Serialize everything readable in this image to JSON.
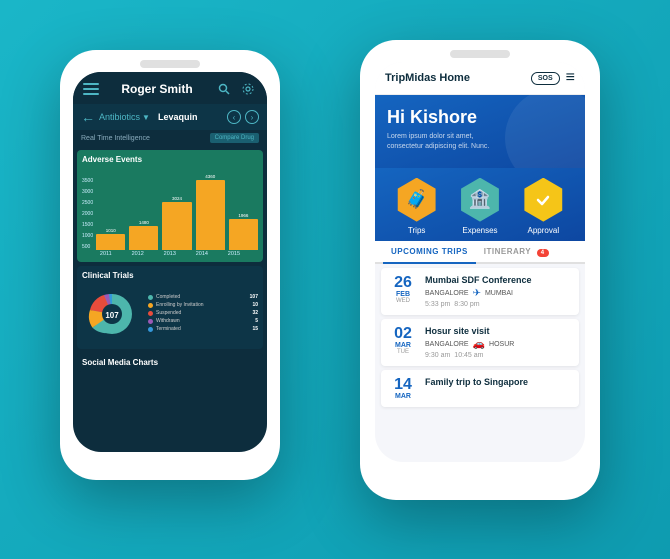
{
  "background_color": "#1ab6c8",
  "left_phone": {
    "header": {
      "title": "Roger Smith",
      "search_icon": "search",
      "settings_icon": "gear"
    },
    "nav": {
      "back_icon": "←",
      "section": "Antibiotics",
      "dropdown_icon": "▼",
      "active_item": "Levaquin",
      "prev_icon": "‹",
      "next_icon": "›"
    },
    "rti_label": "Real Time Intelligence",
    "rti_button": "Compare Drug",
    "chart1": {
      "title": "Adverse Events",
      "y_labels": [
        "3500",
        "3000",
        "2500",
        "2000",
        "1500",
        "1000",
        "500",
        ""
      ],
      "bars": [
        {
          "year": "2011",
          "value": 1010,
          "label": "1010"
        },
        {
          "year": "2012",
          "value": 1480,
          "label": "1480"
        },
        {
          "year": "2013",
          "value": 3024,
          "label": "3024"
        },
        {
          "year": "2014",
          "value": 4360,
          "label": "4360"
        },
        {
          "year": "2015",
          "value": 1966,
          "label": "1966"
        }
      ],
      "max_value": 4500
    },
    "chart2": {
      "title": "Clinical Trials",
      "legend": [
        {
          "label": "Completed",
          "value": "107",
          "color": "#4db6ac"
        },
        {
          "label": "Enrolling by Invitation",
          "value": "10",
          "color": "#f5a623"
        },
        {
          "label": "Suspended",
          "value": "32",
          "color": "#e74c3c"
        },
        {
          "label": "Withdrawn",
          "value": "5",
          "color": "#9b59b6"
        },
        {
          "label": "Terminated",
          "value": "15",
          "color": "#3498db"
        }
      ]
    },
    "chart3": {
      "title": "Social Media Charts"
    }
  },
  "right_phone": {
    "header": {
      "title": "TripMidas Home",
      "sos_label": "SOS",
      "menu_icon": "≡"
    },
    "hero": {
      "greeting": "Hi Kishore",
      "subtitle": "Lorem ipsum dolor sit amet, consectetur adipiscing elit. Nunc."
    },
    "icons": [
      {
        "label": "Trips",
        "icon": "🧳",
        "color": "#f5a623"
      },
      {
        "label": "Expenses",
        "icon": "🏦",
        "color": "#4db6ac"
      },
      {
        "label": "Approval",
        "icon": "✓",
        "color": "#f5c518"
      }
    ],
    "tabs": [
      {
        "label": "UPCOMING TRIPS",
        "active": true,
        "badge": null
      },
      {
        "label": "ITINERARY",
        "active": false,
        "badge": "4"
      }
    ],
    "trips": [
      {
        "day": "26",
        "month": "FEB",
        "weekday": "WED",
        "name": "Mumbai SDF Conference",
        "from": "BANGALORE",
        "to": "MUMBAI",
        "time_start": "5:33 pm",
        "time_end": "8:30 pm",
        "transport": "✈"
      },
      {
        "day": "02",
        "month": "MAR",
        "weekday": "TUE",
        "name": "Hosur site visit",
        "from": "BANGALORE",
        "to": "HOSUR",
        "time_start": "9:30 am",
        "time_end": "10:45 am",
        "transport": "🚗"
      },
      {
        "day": "14",
        "month": "MAR",
        "weekday": "",
        "name": "Family trip to Singapore",
        "from": "",
        "to": "",
        "time_start": "",
        "time_end": "",
        "transport": ""
      }
    ]
  }
}
